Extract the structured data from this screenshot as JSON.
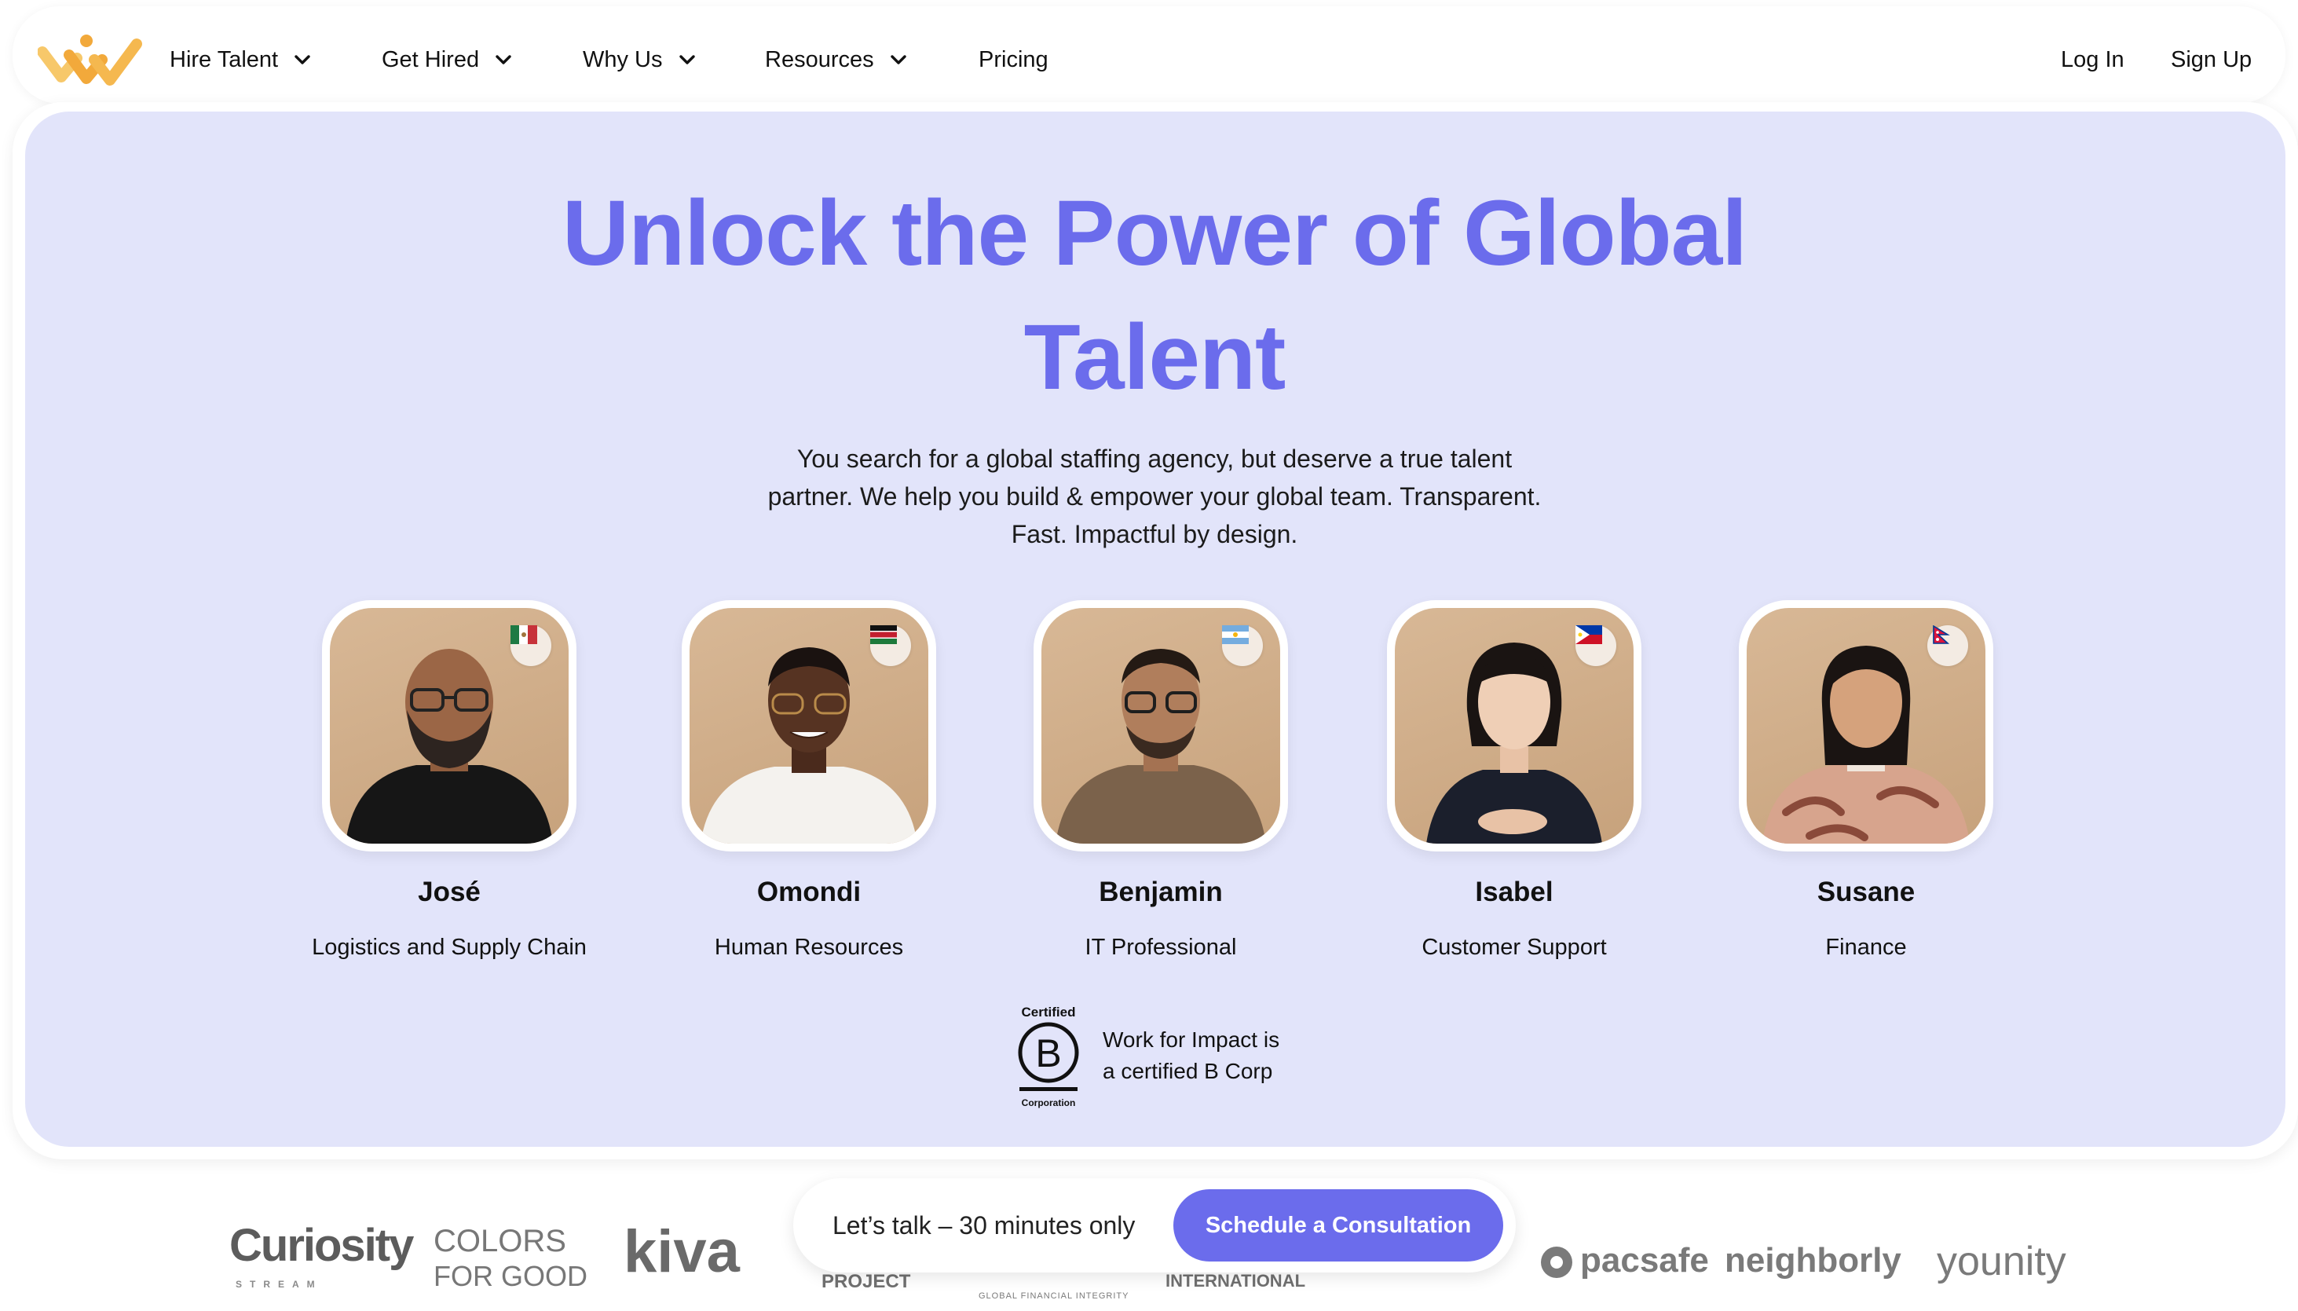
{
  "nav": {
    "logo_icon": "work-for-impact-logo",
    "items": [
      {
        "label": "Hire Talent",
        "has_dropdown": true
      },
      {
        "label": "Get Hired",
        "has_dropdown": true
      },
      {
        "label": "Why Us",
        "has_dropdown": true
      },
      {
        "label": "Resources",
        "has_dropdown": true
      },
      {
        "label": "Pricing",
        "has_dropdown": false
      }
    ],
    "login_label": "Log In",
    "signup_label": "Sign Up"
  },
  "hero": {
    "title_line1": "Unlock the Power of Global",
    "title_line2": "Talent",
    "subtitle_line1": "You search for a global staffing agency, but deserve a true talent",
    "subtitle_line2": "partner. We help you build & empower your global team. Transparent.",
    "subtitle_line3": "Fast. Impactful by design."
  },
  "talents": [
    {
      "name": "José",
      "role": "Logistics and Supply Chain",
      "flag": "mexico-flag"
    },
    {
      "name": "Omondi",
      "role": "Human Resources",
      "flag": "kenya-flag"
    },
    {
      "name": "Benjamin",
      "role": "IT Professional",
      "flag": "argentina-flag"
    },
    {
      "name": "Isabel",
      "role": "Customer Support",
      "flag": "philippines-flag"
    },
    {
      "name": "Susane",
      "role": "Finance",
      "flag": "nepal-flag"
    }
  ],
  "bcorp": {
    "badge_top": "Certified",
    "badge_letter": "B",
    "badge_bottom": "Corporation",
    "text_line1": "Work for Impact is",
    "text_line2": "a certified B Corp"
  },
  "cta": {
    "text": "Let’s talk – 30 minutes only",
    "button_label": "Schedule a Consultation"
  },
  "partner_logos": [
    {
      "name": "Curiosity",
      "tag": "STREAM"
    },
    {
      "name": "COLORS",
      "tag": "FOR GOOD"
    },
    {
      "name": "kiva"
    },
    {
      "name": "PROJECT"
    },
    {
      "name": "GLOBAL FINANCIAL INTEGRITY"
    },
    {
      "name": "INTERNATIONAL"
    },
    {
      "name": "pacsafe"
    },
    {
      "name": "neighborly"
    },
    {
      "name": "younity"
    }
  ],
  "colors": {
    "accent": "#6b6cec",
    "hero_bg": "#e2e4fa",
    "text": "#111111"
  }
}
